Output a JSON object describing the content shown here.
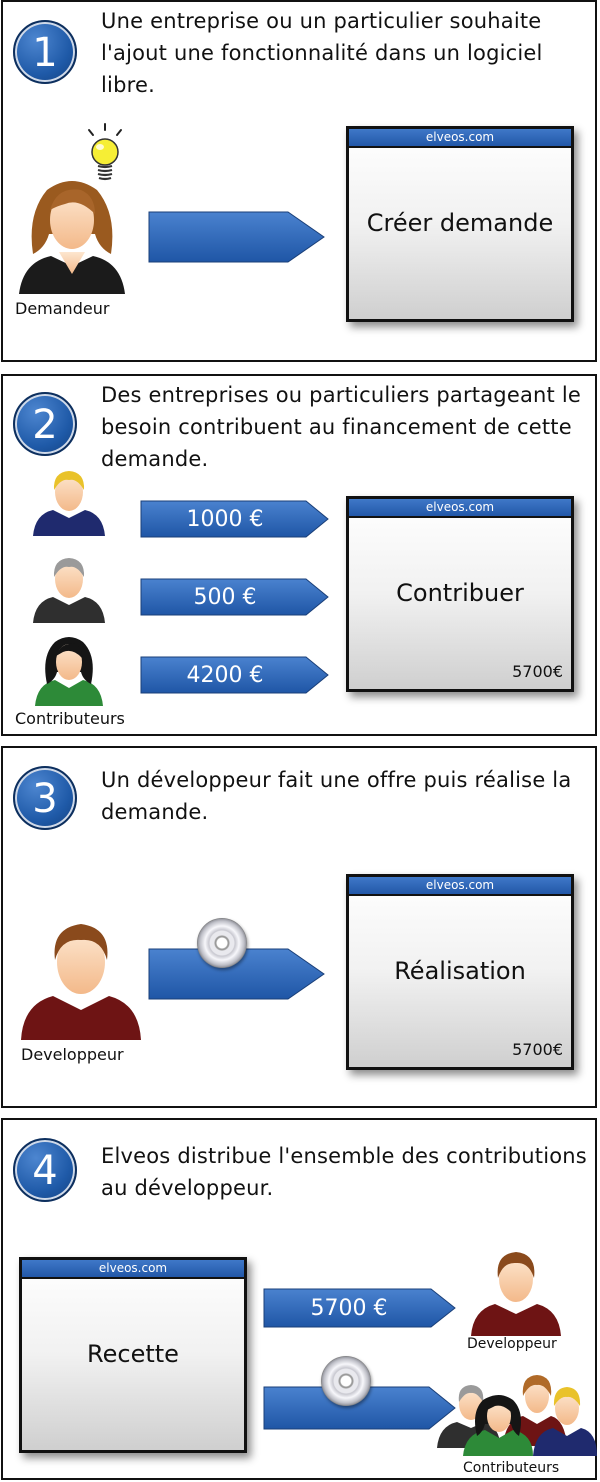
{
  "steps": [
    {
      "number": "1",
      "text": "Une entreprise ou un particulier souhaite l'ajout une fonctionnalité dans un logiciel libre.",
      "window": {
        "site": "elveos.com",
        "label": "Créer demande",
        "amount": ""
      },
      "people_label": "Demandeur"
    },
    {
      "number": "2",
      "text": "Des entreprises ou particuliers partageant le besoin contribuent au financement de cette demande.",
      "window": {
        "site": "elveos.com",
        "label": "Contribuer",
        "amount": "5700€"
      },
      "arrows": [
        "1000 €",
        "500 €",
        "4200 €"
      ],
      "people_label": "Contributeurs"
    },
    {
      "number": "3",
      "text": "Un développeur fait une offre puis réalise la demande.",
      "window": {
        "site": "elveos.com",
        "label": "Réalisation",
        "amount": "5700€"
      },
      "people_label": "Developpeur"
    },
    {
      "number": "4",
      "text": "Elveos distribue l'ensemble des contributions au développeur.",
      "window": {
        "site": "elveos.com",
        "label": "Recette",
        "amount": ""
      },
      "arrows": [
        "5700 €"
      ],
      "developer_label": "Developpeur",
      "contributors_label": "Contributeurs"
    }
  ],
  "colors": {
    "accent": "#2a63b4",
    "badge": "#1f5aa8",
    "frame": "#111111"
  },
  "icons": [
    "lightbulb-icon",
    "cd-icon",
    "person-icon"
  ]
}
